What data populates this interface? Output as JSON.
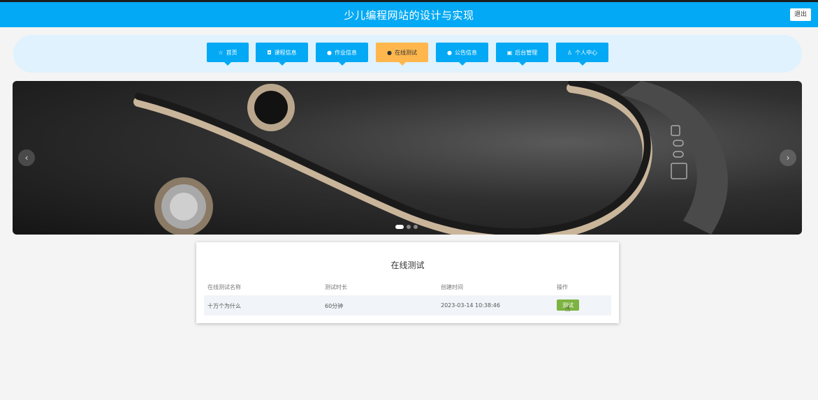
{
  "header": {
    "title": "少儿编程网站的设计与实现",
    "user_text": "",
    "logout_label": "退出"
  },
  "nav": {
    "items": [
      {
        "label": "首页",
        "icon": "star-icon"
      },
      {
        "label": "课程信息",
        "icon": "bag-icon"
      },
      {
        "label": "作业信息",
        "icon": "info-circle-icon"
      },
      {
        "label": "在线测试",
        "icon": "info-circle-icon"
      },
      {
        "label": "公告信息",
        "icon": "info-circle-icon"
      },
      {
        "label": "后台管理",
        "icon": "calendar-icon"
      },
      {
        "label": "个人中心",
        "icon": "user-icon"
      }
    ],
    "active": "在线测试"
  },
  "banner": {
    "prev_glyph": "‹",
    "next_glyph": "›",
    "slides": 3,
    "active_slide": 1
  },
  "test_section": {
    "title": "在线测试",
    "headers": [
      "在线测试名称",
      "测试时长",
      "创建时间",
      "操作"
    ],
    "rows": [
      {
        "name": "十万个为什么",
        "duration": "60分钟",
        "created": "2023-03-14 10:38:46",
        "action": "测试"
      }
    ]
  },
  "colors": {
    "header_bg": "#03a9f4",
    "nav_bg": "#dff2fd",
    "nav_active": "#ffb74d",
    "action_button": "#7cb342"
  }
}
